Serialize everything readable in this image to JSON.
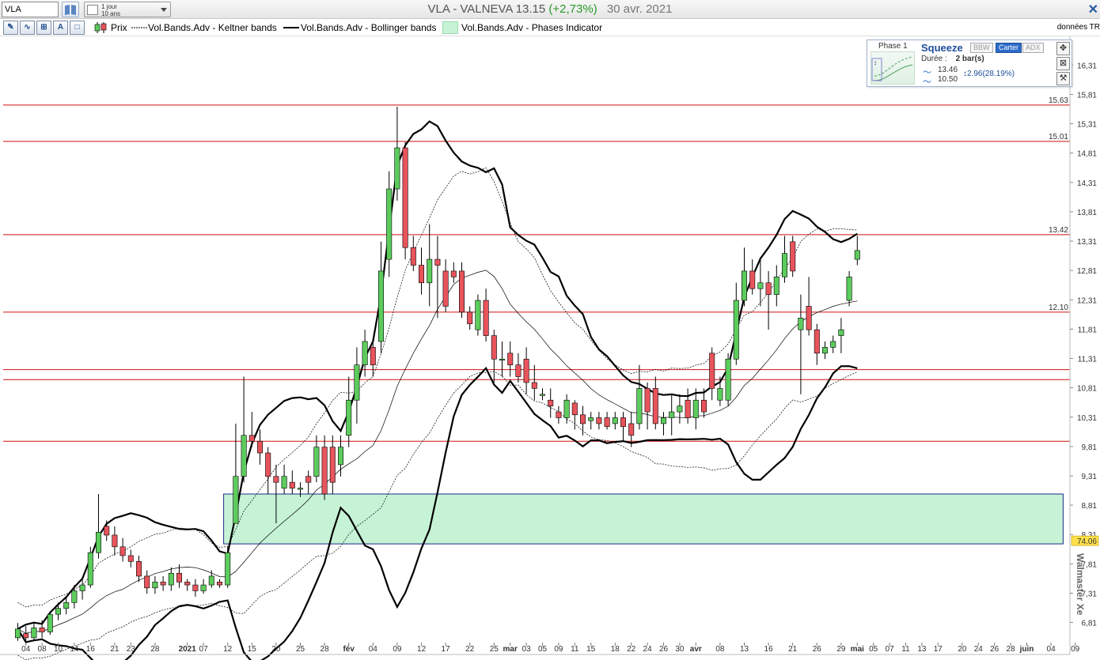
{
  "toolbar": {
    "symbol_value": "VLA",
    "period_line1": "1 jour",
    "period_line2": "10 ans",
    "title_main": "VLA - VALNEVA  13.15",
    "title_change": "(+2,73%)",
    "title_date": "30 avr. 2021"
  },
  "legend": {
    "prix": "Prix",
    "keltner": "Vol.Bands.Adv - Keltner bands",
    "bollinger": "Vol.Bands.Adv - Bollinger bands",
    "phases": "Vol.Bands.Adv - Phases Indicator",
    "donnees": "données TR"
  },
  "squeeze": {
    "phase": "Phase 1",
    "title": "Squeeze",
    "tabs": [
      "BBW",
      "Carter",
      "ADX"
    ],
    "active_tab": "Carter",
    "duree_label": "Durée :",
    "duree_value": "2 bar(s)",
    "val_high": "13.46",
    "val_low": "10.50",
    "range": "2.96(28.19%)"
  },
  "watermark": "Walmaster Xe",
  "colors": {
    "up": "#5ccc5c",
    "down": "#e8545c",
    "level_line": "#d01010",
    "zone_fill": "#c6f3d6",
    "zone_border": "#1a2a8a"
  },
  "chart_data": {
    "type": "candlestick",
    "symbol": "VLA",
    "ylim": [
      6.4,
      16.8
    ],
    "y_ticks": [
      "16,31",
      "15,81",
      "15,31",
      "14,81",
      "14,31",
      "13,81",
      "13,31",
      "12,81",
      "12,31",
      "11,81",
      "11,31",
      "10,81",
      "10,31",
      "9,81",
      "9,31",
      "8,81",
      "8,31",
      "7,81",
      "7,31",
      "6,81"
    ],
    "x_ticks": [
      {
        "label": "04",
        "i": 1
      },
      {
        "label": "08",
        "i": 3
      },
      {
        "label": "10",
        "i": 5
      },
      {
        "label": "14",
        "i": 7
      },
      {
        "label": "16",
        "i": 9
      },
      {
        "label": "21",
        "i": 12
      },
      {
        "label": "23",
        "i": 14
      },
      {
        "label": "28",
        "i": 17
      },
      {
        "label": "2021",
        "i": 21,
        "bold": true
      },
      {
        "label": "07",
        "i": 23
      },
      {
        "label": "12",
        "i": 26
      },
      {
        "label": "15",
        "i": 29
      },
      {
        "label": "20",
        "i": 32
      },
      {
        "label": "25",
        "i": 35
      },
      {
        "label": "28",
        "i": 38
      },
      {
        "label": "fév",
        "i": 41,
        "bold": true
      },
      {
        "label": "04",
        "i": 44
      },
      {
        "label": "09",
        "i": 47
      },
      {
        "label": "12",
        "i": 50
      },
      {
        "label": "17",
        "i": 53
      },
      {
        "label": "22",
        "i": 56
      },
      {
        "label": "25",
        "i": 59
      },
      {
        "label": "mar",
        "i": 61,
        "bold": true
      },
      {
        "label": "03",
        "i": 63
      },
      {
        "label": "05",
        "i": 65
      },
      {
        "label": "09",
        "i": 67
      },
      {
        "label": "11",
        "i": 69
      },
      {
        "label": "15",
        "i": 71
      },
      {
        "label": "18",
        "i": 74
      },
      {
        "label": "22",
        "i": 76
      },
      {
        "label": "24",
        "i": 78
      },
      {
        "label": "26",
        "i": 80
      },
      {
        "label": "30",
        "i": 82
      },
      {
        "label": "avr",
        "i": 84,
        "bold": true
      },
      {
        "label": "08",
        "i": 87
      },
      {
        "label": "13",
        "i": 90
      },
      {
        "label": "16",
        "i": 93
      },
      {
        "label": "21",
        "i": 96
      },
      {
        "label": "26",
        "i": 99
      },
      {
        "label": "29",
        "i": 102
      },
      {
        "label": "mai",
        "i": 104,
        "bold": true
      },
      {
        "label": "05",
        "i": 106
      },
      {
        "label": "07",
        "i": 108
      },
      {
        "label": "11",
        "i": 110
      },
      {
        "label": "13",
        "i": 112
      },
      {
        "label": "17",
        "i": 114
      },
      {
        "label": "20",
        "i": 117
      },
      {
        "label": "24",
        "i": 119
      },
      {
        "label": "26",
        "i": 121
      },
      {
        "label": "28",
        "i": 123
      },
      {
        "label": "juin",
        "i": 125,
        "bold": true
      },
      {
        "label": "04",
        "i": 128
      },
      {
        "label": "09",
        "i": 131
      }
    ],
    "levels": [
      {
        "value": 15.63,
        "label": "15.63"
      },
      {
        "value": 15.01,
        "label": "15.01"
      },
      {
        "value": 13.42,
        "label": "13.42"
      },
      {
        "value": 12.1,
        "label": "12.10"
      },
      {
        "value": 11.12,
        "label": ""
      },
      {
        "value": 10.95,
        "label": ""
      },
      {
        "value": 9.9,
        "label": ""
      }
    ],
    "zone": {
      "i_start": 25.5,
      "i_end": 129.5,
      "y_high": 9.0,
      "y_low": 8.15
    },
    "zone_badge": "74.06",
    "candles": [
      [
        6.55,
        6.7,
        6.5,
        6.8
      ],
      [
        6.62,
        6.55,
        6.45,
        6.75
      ],
      [
        6.55,
        6.72,
        6.5,
        6.8
      ],
      [
        6.72,
        6.65,
        6.55,
        6.85
      ],
      [
        6.65,
        6.95,
        6.6,
        7.0
      ],
      [
        6.95,
        7.05,
        6.85,
        7.15
      ],
      [
        7.05,
        7.15,
        6.95,
        7.25
      ],
      [
        7.15,
        7.35,
        7.05,
        7.45
      ],
      [
        7.35,
        7.45,
        7.2,
        7.55
      ],
      [
        7.45,
        8.0,
        7.4,
        8.1
      ],
      [
        8.0,
        8.35,
        7.9,
        9.0
      ],
      [
        8.45,
        8.3,
        8.2,
        8.55
      ],
      [
        8.3,
        8.1,
        7.95,
        8.45
      ],
      [
        8.1,
        7.95,
        7.85,
        8.25
      ],
      [
        7.95,
        7.85,
        7.75,
        8.05
      ],
      [
        7.85,
        7.6,
        7.5,
        7.95
      ],
      [
        7.6,
        7.4,
        7.3,
        7.7
      ],
      [
        7.4,
        7.5,
        7.3,
        7.6
      ],
      [
        7.5,
        7.45,
        7.35,
        7.6
      ],
      [
        7.45,
        7.65,
        7.35,
        7.75
      ],
      [
        7.65,
        7.5,
        7.4,
        7.8
      ],
      [
        7.5,
        7.45,
        7.35,
        7.55
      ],
      [
        7.45,
        7.35,
        7.25,
        7.55
      ],
      [
        7.35,
        7.45,
        7.3,
        7.55
      ],
      [
        7.45,
        7.6,
        7.4,
        7.7
      ],
      [
        7.5,
        7.45,
        7.4,
        7.55
      ],
      [
        7.45,
        8.0,
        7.4,
        8.1
      ],
      [
        8.5,
        9.3,
        8.5,
        10.2
      ],
      [
        9.3,
        10.0,
        9.2,
        11.0
      ],
      [
        10.0,
        9.9,
        9.8,
        10.4
      ],
      [
        9.9,
        9.7,
        9.5,
        10.1
      ],
      [
        9.7,
        9.3,
        9.0,
        9.8
      ],
      [
        9.3,
        9.2,
        8.5,
        9.5
      ],
      [
        9.1,
        9.3,
        9.0,
        9.5
      ],
      [
        9.2,
        9.1,
        9.0,
        9.4
      ],
      [
        9.1,
        9.1,
        8.95,
        9.2
      ],
      [
        9.3,
        9.2,
        9.0,
        9.4
      ],
      [
        9.3,
        9.8,
        9.2,
        10.0
      ],
      [
        9.8,
        9.0,
        8.9,
        10.0
      ],
      [
        9.8,
        9.2,
        9.0,
        10.0
      ],
      [
        9.5,
        9.8,
        9.3,
        10.0
      ],
      [
        10.0,
        10.6,
        9.8,
        11.0
      ],
      [
        10.6,
        11.2,
        10.2,
        11.5
      ],
      [
        11.2,
        11.6,
        11.0,
        11.8
      ],
      [
        11.5,
        11.2,
        11.0,
        11.6
      ],
      [
        11.6,
        12.8,
        11.4,
        13.3
      ],
      [
        13.0,
        14.2,
        12.7,
        14.5
      ],
      [
        14.2,
        14.9,
        14.0,
        15.6
      ],
      [
        14.9,
        13.2,
        13.0,
        15.0
      ],
      [
        13.2,
        12.9,
        12.8,
        13.4
      ],
      [
        12.9,
        12.6,
        12.4,
        13.2
      ],
      [
        12.6,
        13.0,
        12.2,
        13.6
      ],
      [
        13.0,
        12.9,
        12.0,
        13.4
      ],
      [
        12.8,
        12.2,
        12.1,
        13.0
      ],
      [
        12.8,
        12.7,
        12.6,
        12.95
      ],
      [
        12.8,
        12.1,
        12.0,
        12.95
      ],
      [
        12.1,
        11.9,
        11.8,
        12.2
      ],
      [
        11.8,
        12.3,
        11.7,
        12.4
      ],
      [
        12.3,
        11.7,
        11.6,
        12.5
      ],
      [
        11.7,
        11.3,
        10.9,
        11.8
      ],
      [
        11.3,
        11.3,
        11.0,
        11.6
      ],
      [
        11.4,
        11.2,
        11.0,
        11.6
      ],
      [
        11.2,
        11.0,
        10.9,
        11.4
      ],
      [
        11.3,
        10.9,
        10.7,
        11.5
      ],
      [
        10.9,
        10.8,
        10.6,
        11.2
      ],
      [
        10.7,
        10.7,
        10.6,
        10.8
      ],
      [
        10.6,
        10.5,
        10.3,
        10.8
      ],
      [
        10.4,
        10.3,
        10.2,
        10.5
      ],
      [
        10.3,
        10.6,
        10.2,
        10.7
      ],
      [
        10.55,
        10.35,
        10.1,
        10.6
      ],
      [
        10.35,
        10.2,
        10.0,
        10.5
      ],
      [
        10.25,
        10.3,
        10.1,
        10.4
      ],
      [
        10.3,
        10.2,
        10.1,
        10.4
      ],
      [
        10.3,
        10.15,
        10.1,
        10.4
      ],
      [
        10.2,
        10.3,
        10.1,
        10.4
      ],
      [
        10.3,
        10.15,
        9.9,
        10.4
      ],
      [
        10.2,
        10.0,
        9.8,
        10.4
      ],
      [
        10.2,
        10.8,
        10.1,
        11.2
      ],
      [
        10.8,
        10.4,
        10.1,
        10.9
      ],
      [
        10.8,
        10.2,
        10.1,
        11.0
      ],
      [
        10.2,
        10.3,
        10.0,
        10.4
      ],
      [
        10.3,
        10.4,
        10.0,
        10.7
      ],
      [
        10.4,
        10.5,
        10.2,
        10.7
      ],
      [
        10.6,
        10.3,
        10.2,
        10.8
      ],
      [
        10.3,
        10.6,
        10.1,
        10.8
      ],
      [
        10.6,
        10.4,
        10.3,
        10.8
      ],
      [
        11.4,
        10.8,
        10.6,
        11.5
      ],
      [
        10.6,
        10.8,
        10.5,
        11.0
      ],
      [
        10.6,
        11.3,
        10.5,
        11.4
      ],
      [
        11.3,
        12.3,
        11.2,
        12.6
      ],
      [
        12.3,
        12.8,
        12.2,
        13.2
      ],
      [
        12.8,
        12.5,
        12.4,
        13.0
      ],
      [
        12.5,
        12.6,
        12.2,
        13.0
      ],
      [
        12.6,
        12.4,
        11.8,
        12.8
      ],
      [
        12.4,
        12.7,
        12.2,
        12.9
      ],
      [
        12.7,
        13.1,
        12.6,
        13.4
      ],
      [
        13.3,
        12.8,
        12.7,
        13.4
      ],
      [
        11.8,
        12.0,
        10.7,
        12.4
      ],
      [
        12.2,
        11.8,
        11.7,
        12.7
      ],
      [
        11.8,
        11.4,
        11.2,
        11.9
      ],
      [
        11.4,
        11.5,
        11.3,
        11.6
      ],
      [
        11.5,
        11.6,
        11.4,
        11.7
      ],
      [
        11.7,
        11.8,
        11.4,
        12.0
      ],
      [
        12.3,
        12.7,
        12.2,
        12.8
      ],
      [
        13.0,
        13.15,
        12.9,
        13.4
      ]
    ]
  }
}
